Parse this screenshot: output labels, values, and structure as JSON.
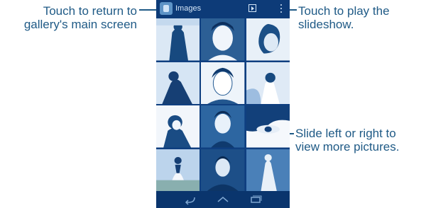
{
  "callouts": {
    "return": [
      "Touch to return to",
      "gallery's main screen"
    ],
    "play": [
      "Touch to play the",
      "slideshow."
    ],
    "slide": [
      "Slide left or right to",
      "view more pictures."
    ]
  },
  "app_bar": {
    "title": "Images",
    "icons": [
      "gallery-app-icon",
      "slideshow-play-icon",
      "overflow-menu-icon"
    ]
  },
  "gallery": {
    "rows": 4,
    "columns": 3,
    "thumbnails": 12
  },
  "nav_bar": {
    "icons": [
      "back-icon",
      "home-icon",
      "recent-apps-icon"
    ]
  },
  "colors": {
    "accent": "#1f5a86",
    "phone_background": "#0f3f80",
    "action_bar": "#0d3b78"
  }
}
